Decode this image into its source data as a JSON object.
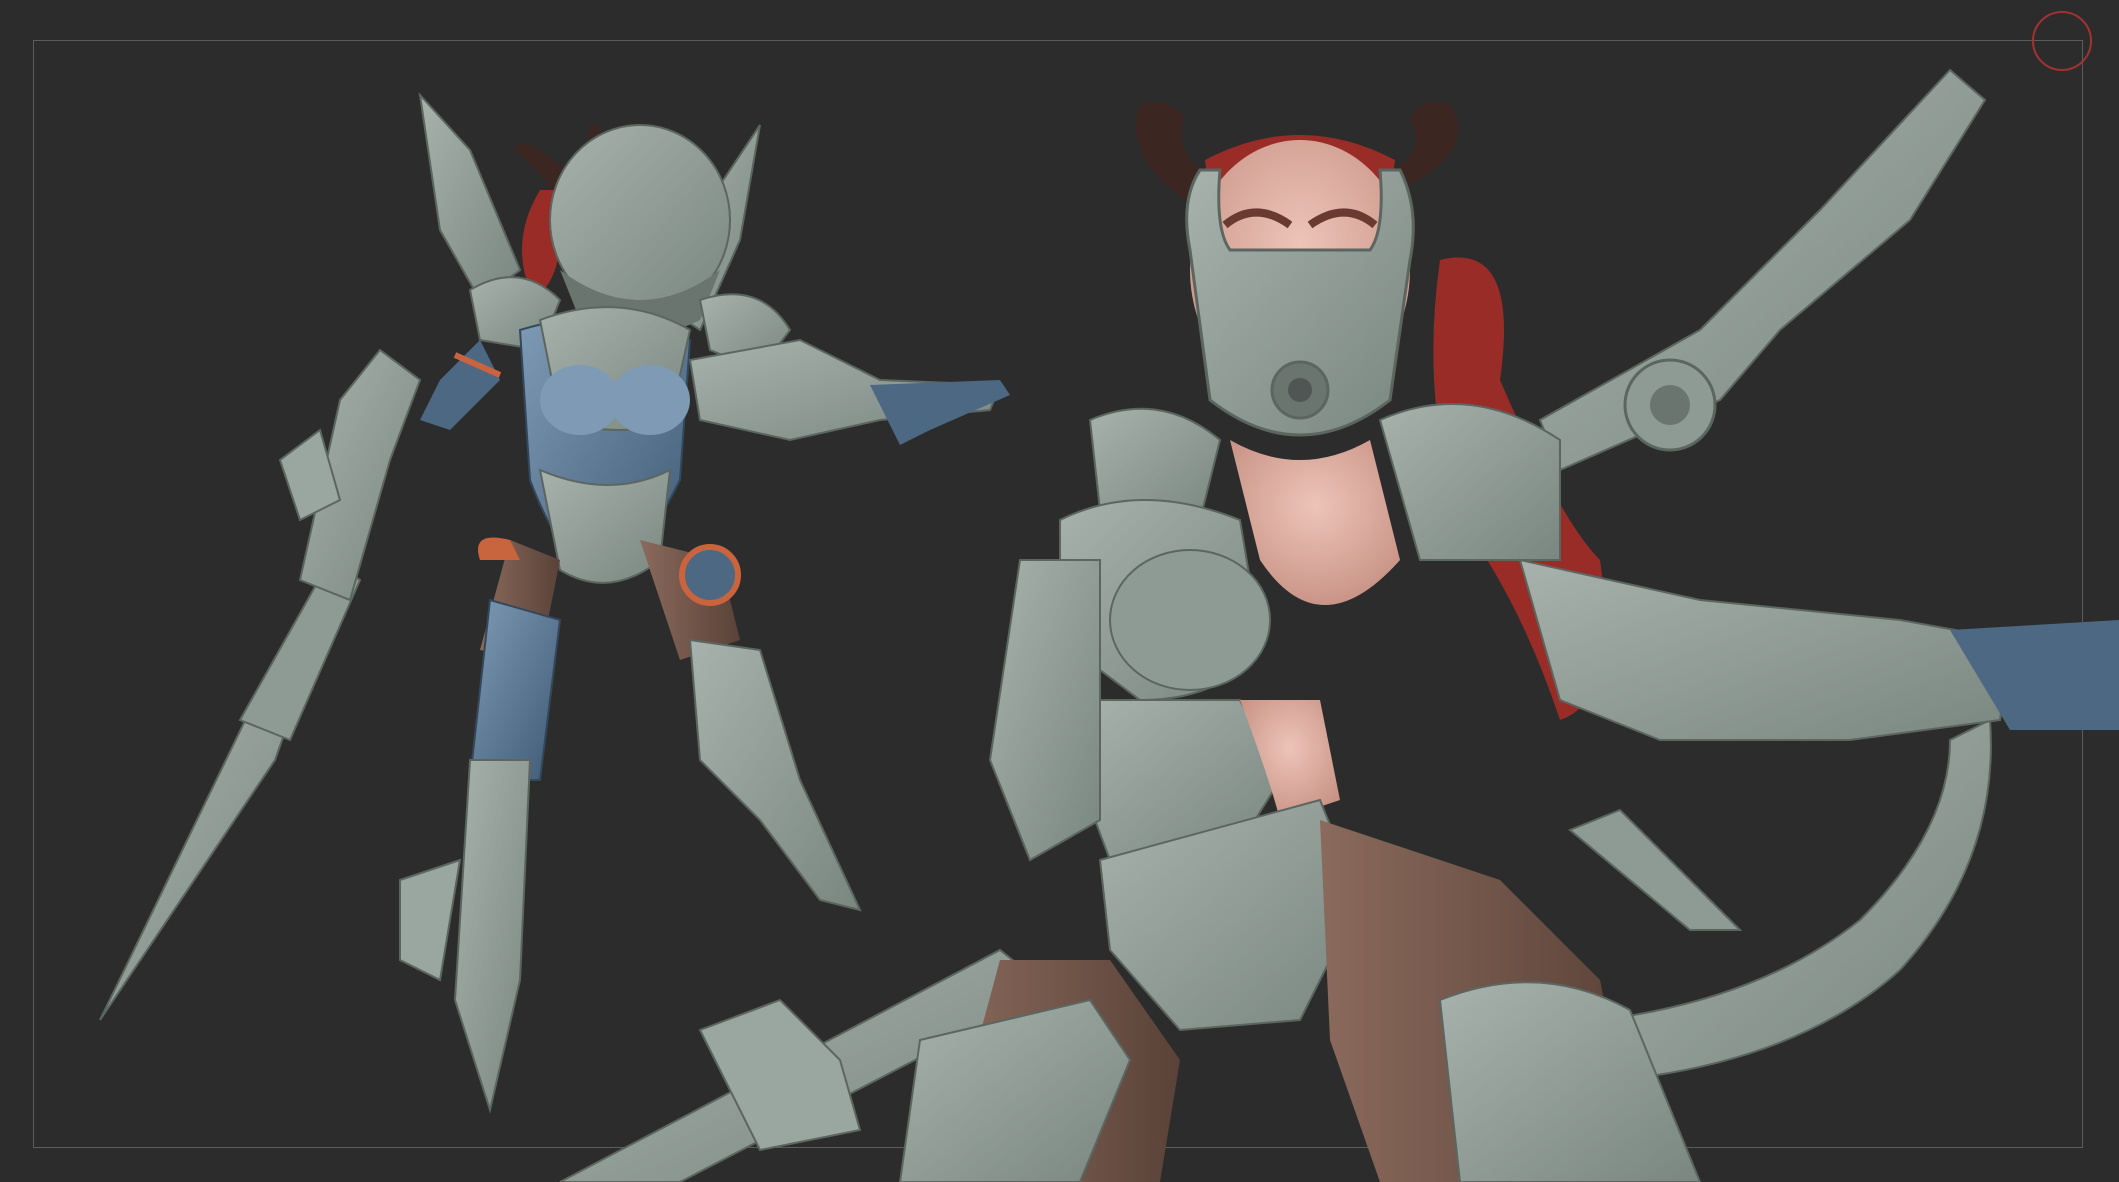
{
  "canvas": {
    "background": "#2c2c2c",
    "frame_color": "#5c5c5c",
    "gizmo_color": "#a23232"
  },
  "subject": {
    "palette": {
      "armor_clay": "#8e9a94",
      "armor_light": "#a7b2ad",
      "armor_dark": "#6b7570",
      "suit_blue": "#4d6882",
      "suit_blue_light": "#7f9ab5",
      "skin": "#d8a99e",
      "stocking": "#6e5348",
      "hair_red": "#9a2c28",
      "horn": "#3b2622",
      "accent_orange": "#c9643e",
      "eye_amber": "#d79b2c"
    }
  }
}
